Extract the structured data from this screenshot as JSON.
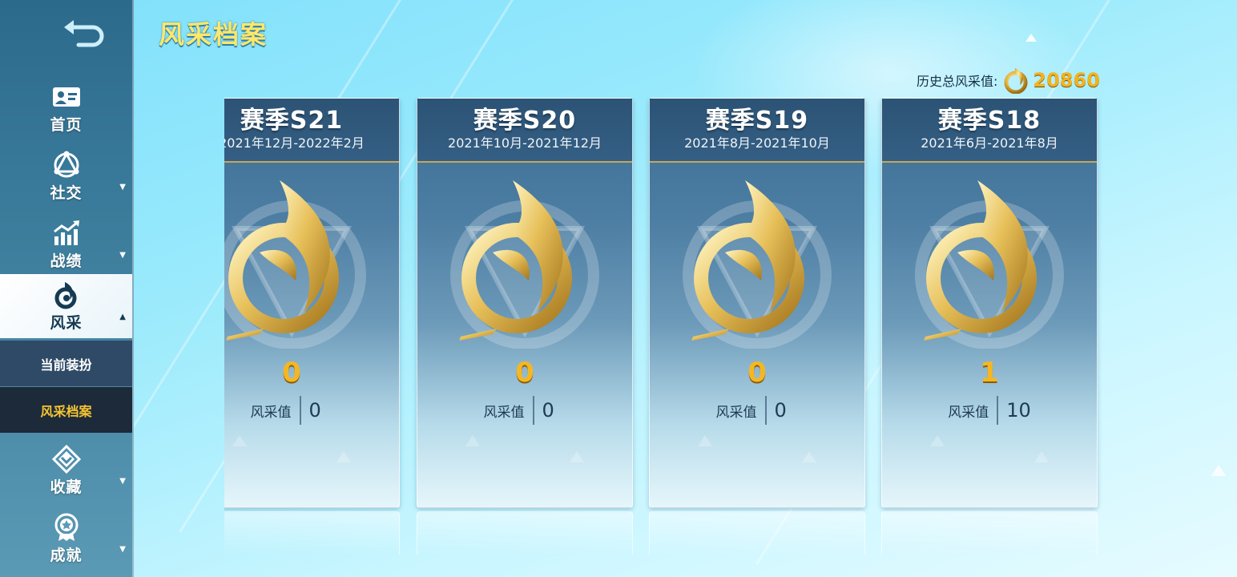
{
  "page": {
    "title": "风采档案",
    "total_label": "历史总风采值:",
    "total_value": "20860"
  },
  "sidebar": {
    "items": [
      {
        "id": "home",
        "label": "首页",
        "icon": "id-card-icon",
        "has_arrow": false
      },
      {
        "id": "social",
        "label": "社交",
        "icon": "social-network-icon",
        "has_arrow": true,
        "arrow": "▼"
      },
      {
        "id": "record",
        "label": "战绩",
        "icon": "stats-chart-icon",
        "has_arrow": true,
        "arrow": "▼"
      },
      {
        "id": "style",
        "label": "风采",
        "icon": "flame-emblem-icon",
        "has_arrow": true,
        "arrow": "▲",
        "active": true
      },
      {
        "id": "collection",
        "label": "收藏",
        "icon": "diamond-badge-icon",
        "has_arrow": true,
        "arrow": "▼"
      },
      {
        "id": "achievement",
        "label": "成就",
        "icon": "medal-icon",
        "has_arrow": true,
        "arrow": "▼"
      }
    ],
    "sub_items": [
      {
        "label": "当前装扮"
      },
      {
        "label": "风采档案",
        "selected": true
      }
    ]
  },
  "seasons": [
    {
      "name": "赛季S21",
      "dates": "2021年12月-2022年2月",
      "level": "0",
      "stat_label": "风采值",
      "stat_value": "0"
    },
    {
      "name": "赛季S20",
      "dates": "2021年10月-2021年12月",
      "level": "0",
      "stat_label": "风采值",
      "stat_value": "0"
    },
    {
      "name": "赛季S19",
      "dates": "2021年8月-2021年10月",
      "level": "0",
      "stat_label": "风采值",
      "stat_value": "0"
    },
    {
      "name": "赛季S18",
      "dates": "2021年6月-2021年8月",
      "level": "1",
      "stat_label": "风采值",
      "stat_value": "10"
    }
  ],
  "colors": {
    "title_yellow": "#fde76a",
    "gold": "#f4b723",
    "sub_selected_text": "#f5c431"
  }
}
